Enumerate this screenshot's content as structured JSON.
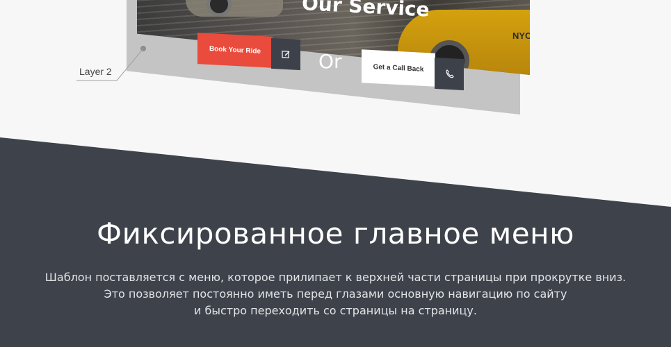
{
  "hero": {
    "title_fragment": "Our Service",
    "book_button_label": "Book Your Ride",
    "or_label": "Or",
    "call_button_label": "Get a Call Back",
    "plate_text": "NYC"
  },
  "annotation": {
    "layer_label": "Layer 2"
  },
  "section": {
    "title": "Фиксированное главное меню",
    "description_lines": [
      "Шаблон поставляется с меню, которое прилипает к верхней части страницы при прокрутке вниз.",
      "Это позволяет постоянно иметь перед глазами основную навигацию по сайту",
      "и быстро переходить со страницы на страницу."
    ]
  },
  "colors": {
    "accent_red": "#e94b3c",
    "dark_panel": "#3e434b",
    "icon_block": "#3d4149",
    "taxi_yellow": "#d4a10f"
  },
  "icons": {
    "book_icon": "edit-icon",
    "call_icon": "phone-icon"
  }
}
